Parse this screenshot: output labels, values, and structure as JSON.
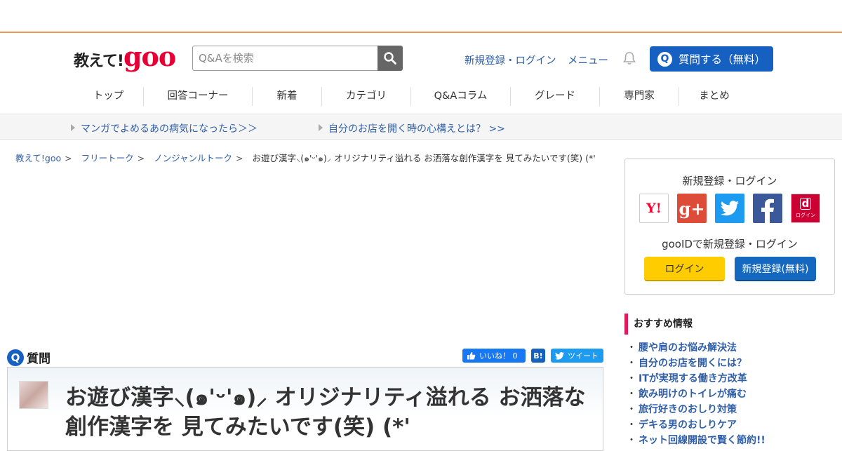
{
  "header": {
    "logo_jp": "教えて!",
    "logo_goo": "goo",
    "search_placeholder": "Q&Aを検索",
    "register_login": "新規登録・ログイン",
    "menu": "メニュー",
    "ask_label": "質問する（無料）",
    "ask_q": "Q"
  },
  "nav": {
    "items": [
      "トップ",
      "回答コーナー",
      "新着",
      "カテゴリ",
      "Q&Aコラム",
      "グレード",
      "専門家",
      "まとめ"
    ]
  },
  "promo": {
    "items": [
      "マンガでよめるあの病気になったら＞＞",
      "自分のお店を開く時の心構えとは？ >>"
    ]
  },
  "breadcrumb": {
    "items": [
      "教えて!goo",
      "フリートーク",
      "ノンジャンルトーク"
    ],
    "current": "お遊び漢字⸜(๑'ᵕ'๑)⸝ オリジナリティ溢れる お洒落な創作漢字を 見てみたいです(笑) (*'"
  },
  "question": {
    "q": "Q",
    "label": "質問",
    "title": "お遊び漢字⸜(๑'ᵕ'๑)⸝ オリジナリティ溢れる お洒落な創作漢字を 見てみたいです(笑) (*'",
    "share": {
      "like": "いいね！ 0",
      "hatena": "B!",
      "tweet": "ツイート"
    }
  },
  "sidebar": {
    "login_title": "新規登録・ログイン",
    "sns": {
      "yahoo": "Y!",
      "google": "g+",
      "dmark": "d",
      "dmark_sub": "ログイン"
    },
    "gooid_text": "gooIDで新規登録・ログイン",
    "login_button": "ログイン",
    "register_button": "新規登録(無料)",
    "recommend_title": "おすすめ情報",
    "recommend": [
      "腰や肩のお悩み解決法",
      "自分のお店を開くには？",
      "ITが実現する働き方改革",
      "飲み明けのトイレが痛む",
      "旅行好きのおしり対策",
      "デキる男のおしりケア",
      "ネット回線開設で賢く節約!!"
    ]
  },
  "colors": {
    "accent_orange": "#f0945a",
    "goo_red": "#e60033",
    "primary_blue": "#1560c0",
    "link_blue": "#2f5fa8",
    "login_yellow": "#ffcc00",
    "recommend_pink": "#e4185a"
  }
}
